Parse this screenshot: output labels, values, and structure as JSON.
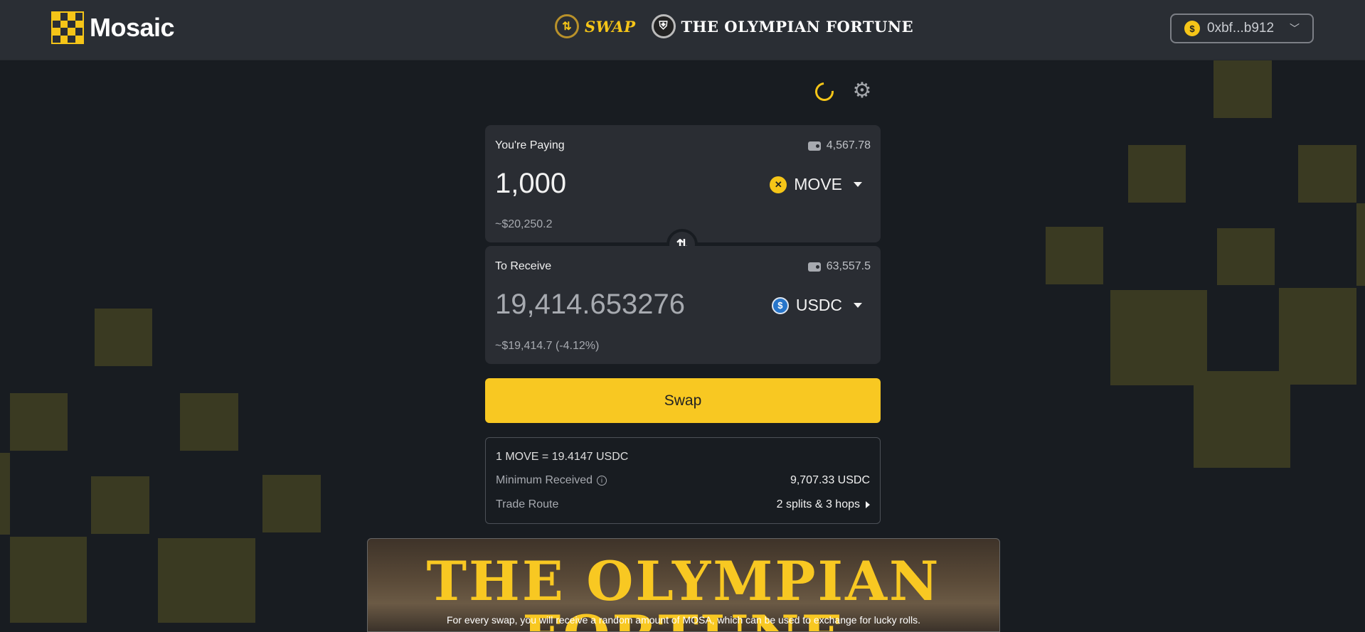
{
  "header": {
    "logo_text": "Mosaic",
    "nav": [
      {
        "label": "SWAP",
        "icon": "swap-arrows-icon"
      },
      {
        "label": "THE OLYMPIAN FORTUNE",
        "icon": "spartan-helmet-icon"
      }
    ],
    "wallet": {
      "address": "0xbf...b912",
      "icon": "wallet-coin-icon"
    }
  },
  "toolbar": {
    "refresh_icon": "refresh-icon",
    "settings_icon": "gear-icon"
  },
  "pay": {
    "label": "You're Paying",
    "balance": "4,567.78",
    "amount": "1,000",
    "token": "MOVE",
    "usd_value": "~$20,250.2"
  },
  "receive": {
    "label": "To Receive",
    "balance": "63,557.5",
    "amount": "19,414.653276",
    "token": "USDC",
    "usd_value": "~$19,414.7 (-4.12%)"
  },
  "swap_button": {
    "label": "Swap"
  },
  "details": {
    "rate": "1 MOVE = 19.4147 USDC",
    "min_received_label": "Minimum Received",
    "min_received_value": "9,707.33 USDC",
    "trade_route_label": "Trade Route",
    "trade_route_value": "2 splits & 3 hops"
  },
  "banner": {
    "title": "THE OLYMPIAN FORTUNE",
    "subtitle": "For every swap, you will receive a random amount of MOSA, which can be used to exchange for lucky rolls."
  },
  "colors": {
    "accent": "#f8c822",
    "background": "#181c21",
    "panel": "#2a2d33",
    "usdc": "#2775ca"
  }
}
